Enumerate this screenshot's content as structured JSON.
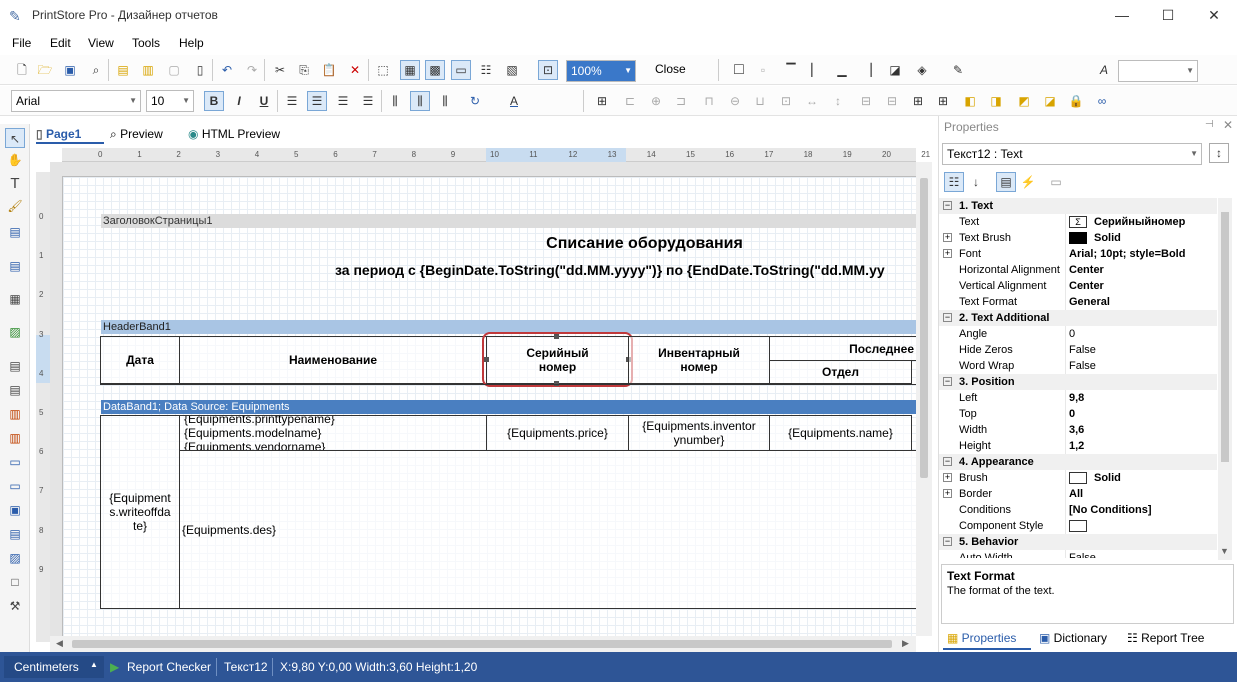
{
  "window": {
    "title": "PrintStore Pro - Дизайнер отчетов"
  },
  "menu": [
    "File",
    "Edit",
    "View",
    "Tools",
    "Help"
  ],
  "toolbar": {
    "zoom": "100%",
    "close_label": "Close",
    "font": "Arial",
    "size": "10"
  },
  "tabs": {
    "page": "Page1",
    "preview": "Preview",
    "html": "HTML Preview"
  },
  "ruler_h": [
    "0",
    "1",
    "2",
    "3",
    "4",
    "5",
    "6",
    "7",
    "8",
    "9",
    "10",
    "11",
    "12",
    "13",
    "14",
    "15",
    "16",
    "17",
    "18",
    "19",
    "20",
    "21"
  ],
  "ruler_v": [
    "0",
    "1",
    "2",
    "3",
    "4",
    "5",
    "6",
    "7",
    "8",
    "9"
  ],
  "report": {
    "page_header": "ЗаголовокСтраницы1",
    "title": "Списание оборудования",
    "subtitle": "за период с {BeginDate.ToString(\"dd.MM.yyyy\")} по {EndDate.ToString(\"dd.MM.yy",
    "header_band": "HeaderBand1",
    "col_date": "Дата",
    "col_name": "Наименование",
    "col_serial_1": "Серийный",
    "col_serial_2": "номер",
    "col_inv_1": "Инвентарный",
    "col_inv_2": "номер",
    "col_last": "Последнее",
    "col_dept": "Отдел",
    "data_band": "DataBand1; Data Source: Equipments",
    "d_type": "{Equipments.printtypename}",
    "d_model": "{Equipments.modelname}",
    "d_vendor": "{Equipments.vendorname}",
    "d_price": "{Equipments.price}",
    "d_inv_1": "{Equipments.inventor",
    "d_inv_2": "ynumber}",
    "d_name": "{Equipments.name}",
    "d_wo_1": "{Equipment",
    "d_wo_2": "s.writeoffda",
    "d_wo_3": "te}",
    "d_des": "{Equipments.des}"
  },
  "properties": {
    "panel_title": "Properties",
    "object": "Текст12 : Text",
    "rows": [
      {
        "type": "cat",
        "name": "1. Text"
      },
      {
        "name": "Text",
        "value": "Серийныйномер",
        "bold": true
      },
      {
        "name": "Text Brush",
        "value": "Solid",
        "bold": true,
        "exp": true
      },
      {
        "name": "Font",
        "value": "Arial; 10pt; style=Bold",
        "bold": true,
        "exp": true
      },
      {
        "name": "Horizontal Alignment",
        "value": "Center",
        "bold": true
      },
      {
        "name": "Vertical Alignment",
        "value": "Center",
        "bold": true
      },
      {
        "name": "Text Format",
        "value": "General",
        "bold": true
      },
      {
        "type": "cat",
        "name": "2. Text  Additional"
      },
      {
        "name": "Angle",
        "value": "0"
      },
      {
        "name": "Hide Zeros",
        "value": "False"
      },
      {
        "name": "Word Wrap",
        "value": "False"
      },
      {
        "type": "cat",
        "name": "3. Position"
      },
      {
        "name": "Left",
        "value": "9,8",
        "bold": true
      },
      {
        "name": "Top",
        "value": "0",
        "bold": true
      },
      {
        "name": "Width",
        "value": "3,6",
        "bold": true
      },
      {
        "name": "Height",
        "value": "1,2",
        "bold": true
      },
      {
        "type": "cat",
        "name": "4. Appearance"
      },
      {
        "name": "Brush",
        "value": "Solid",
        "bold": true,
        "exp": true
      },
      {
        "name": "Border",
        "value": "All",
        "bold": true,
        "exp": true
      },
      {
        "name": "Conditions",
        "value": "[No Conditions]",
        "bold": true
      },
      {
        "name": "Component Style",
        "value": ""
      },
      {
        "type": "cat",
        "name": "5. Behavior"
      },
      {
        "name": "Auto Width",
        "value": "False"
      }
    ],
    "desc_title": "Text Format",
    "desc_text": "The format of the text.",
    "tab_props": "Properties",
    "tab_dict": "Dictionary",
    "tab_tree": "Report Tree"
  },
  "status": {
    "units": "Centimeters",
    "checker": "Report Checker",
    "component": "Текст12",
    "coords": "X:9,80  Y:0,00  Width:3,60  Height:1,20"
  }
}
